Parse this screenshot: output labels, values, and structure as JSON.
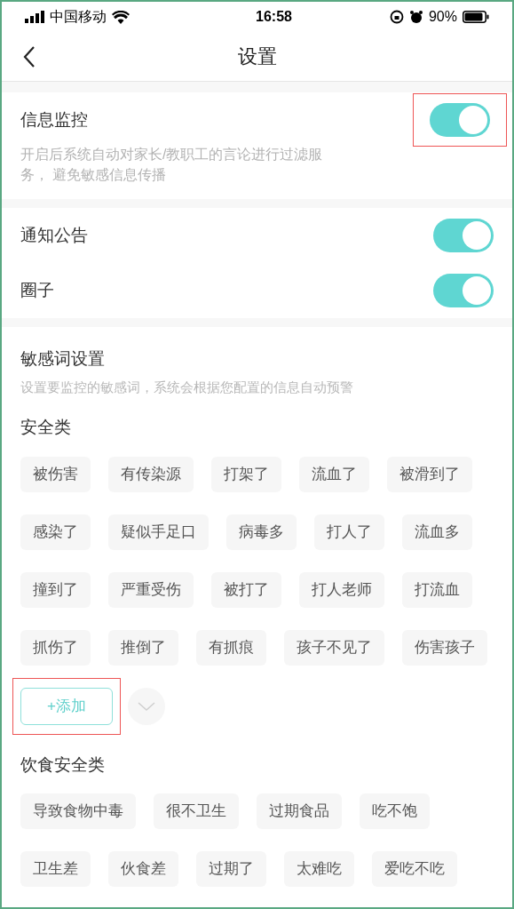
{
  "status_bar": {
    "carrier": "中国移动",
    "time": "16:58",
    "battery": "90%"
  },
  "nav": {
    "title": "设置"
  },
  "groups": [
    {
      "items": [
        {
          "label": "信息监控",
          "on": true,
          "highlighted": true,
          "description": "开启后系统自动对家长/教职工的言论进行过滤服务， 避免敏感信息传播"
        }
      ]
    },
    {
      "items": [
        {
          "label": "通知公告",
          "on": true,
          "highlighted": false
        },
        {
          "label": "圈子",
          "on": true,
          "highlighted": false
        }
      ]
    }
  ],
  "sensitive_words": {
    "title": "敏感词设置",
    "description": "设置要监控的敏感词，系统会根据您配置的信息自动预警",
    "categories": [
      {
        "title": "安全类",
        "tags": [
          "被伤害",
          "有传染源",
          "打架了",
          "流血了",
          "被滑到了",
          "感染了",
          "疑似手足口",
          "病毒多",
          "打人了",
          "流血多",
          "撞到了",
          "严重受伤",
          "被打了",
          "打人老师",
          "打流血",
          "抓伤了",
          "推倒了",
          "有抓痕",
          "孩子不见了",
          "伤害孩子"
        ],
        "add_button": "+添加"
      },
      {
        "title": "饮食安全类",
        "tags": [
          "导致食物中毒",
          "很不卫生",
          "过期食品",
          "吃不饱",
          "卫生差",
          "伙食差",
          "过期了",
          "太难吃",
          "爱吃不吃"
        ]
      }
    ]
  }
}
